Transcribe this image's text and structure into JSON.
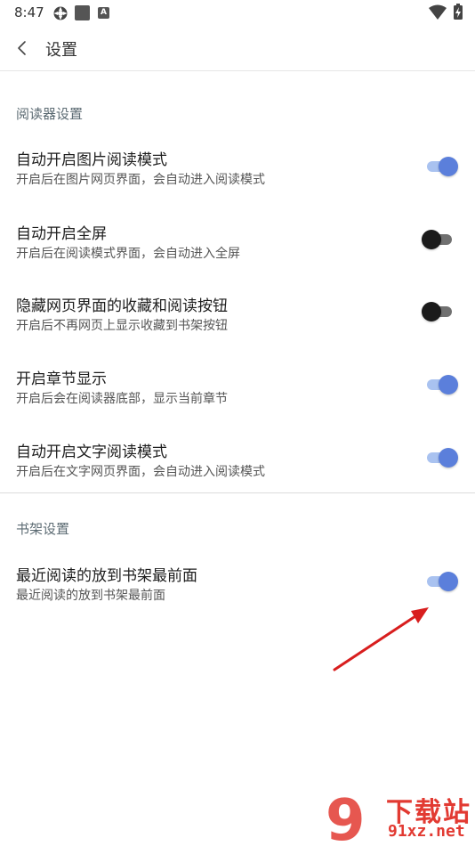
{
  "status_bar": {
    "time": "8:47",
    "icons": [
      "settings-gear-icon",
      "square-app-icon",
      "text-a-icon",
      "wifi-icon",
      "battery-charging-icon"
    ],
    "text_icon_glyph": "A"
  },
  "header": {
    "title": "设置",
    "back_icon": "chevron-left-icon"
  },
  "sections": [
    {
      "title": "阅读器设置",
      "items": [
        {
          "title": "自动开启图片阅读模式",
          "subtitle": "开启后在图片网页界面，会自动进入阅读模式",
          "enabled": true
        },
        {
          "title": "自动开启全屏",
          "subtitle": "开启后在阅读模式界面，会自动进入全屏",
          "enabled": false
        },
        {
          "title": "隐藏网页界面的收藏和阅读按钮",
          "subtitle": "开启后不再网页上显示收藏到书架按钮",
          "enabled": false
        },
        {
          "title": "开启章节显示",
          "subtitle": "开启后会在阅读器底部，显示当前章节",
          "enabled": true
        },
        {
          "title": "自动开启文字阅读模式",
          "subtitle": "开启后在文字网页界面，会自动进入阅读模式",
          "enabled": true
        }
      ]
    },
    {
      "title": "书架设置",
      "items": [
        {
          "title": "最近阅读的放到书架最前面",
          "subtitle": "最近阅读的放到书架最前面",
          "enabled": true
        }
      ]
    }
  ],
  "colors": {
    "toggle_on_thumb": "#5b7fdb",
    "toggle_on_track": "#a9c2f0",
    "toggle_off_thumb": "#1b1b1b",
    "toggle_off_track": "#707070",
    "annotation_arrow": "#d81e1e",
    "watermark": "#e23a32"
  },
  "watermark": {
    "logo_text": "9",
    "text": "下载站",
    "url": "91xz.net"
  }
}
